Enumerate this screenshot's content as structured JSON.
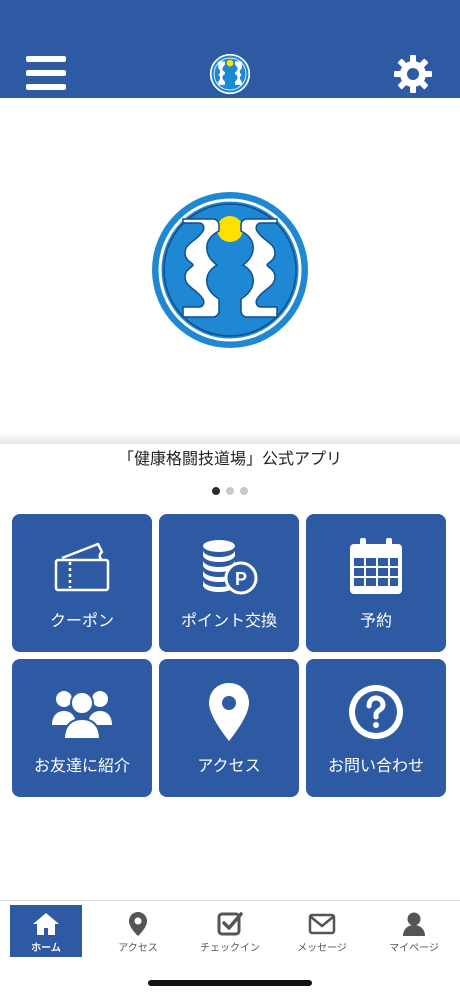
{
  "header": {
    "menu_icon": "hamburger-menu-icon",
    "logo_icon": "dojo-logo-icon",
    "settings_icon": "gear-icon",
    "background": "#2d5aa2"
  },
  "hero": {
    "logo_icon": "dojo-logo-icon",
    "caption": "「健康格闘技道場」公式アプリ",
    "carousel_total": 3,
    "carousel_current": 1
  },
  "tiles": [
    {
      "label": "クーポン",
      "icon": "ticket-icon"
    },
    {
      "label": "ポイント交換",
      "icon": "coins-points-icon"
    },
    {
      "label": "予約",
      "icon": "calendar-icon"
    },
    {
      "label": "お友達に紹介",
      "icon": "users-group-icon"
    },
    {
      "label": "アクセス",
      "icon": "map-pin-icon"
    },
    {
      "label": "お問い合わせ",
      "icon": "question-circle-icon"
    }
  ],
  "tabbar": {
    "active_index": 0,
    "items": [
      {
        "label": "ホーム",
        "icon": "home-icon"
      },
      {
        "label": "アクセス",
        "icon": "map-pin-icon"
      },
      {
        "label": "チェックイン",
        "icon": "checkbox-icon"
      },
      {
        "label": "メッセージ",
        "icon": "envelope-icon"
      },
      {
        "label": "マイページ",
        "icon": "user-icon"
      }
    ]
  },
  "colors": {
    "brand_blue": "#2d5aa2",
    "logo_blue": "#1e88d4",
    "logo_yellow": "#ffe100"
  }
}
